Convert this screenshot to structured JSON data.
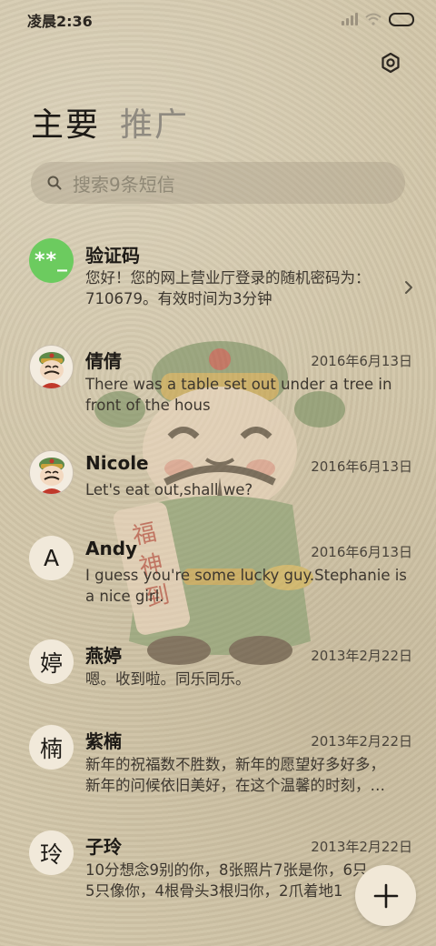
{
  "status_bar": {
    "time": "凌晨2:36"
  },
  "header": {
    "settings_icon": "gear-icon"
  },
  "tabs": [
    {
      "label": "主要",
      "active": true
    },
    {
      "label": "推广",
      "active": false
    }
  ],
  "search": {
    "placeholder": "搜索9条短信"
  },
  "messages": [
    {
      "name": "验证码",
      "avatar_text": "**_",
      "avatar_type": "code",
      "date": "",
      "preview": "您好！您的网上营业厅登录的随机密码为：\n710679。有效时间为3分钟",
      "has_chevron": true
    },
    {
      "name": "倩倩",
      "avatar_type": "photo",
      "date": "2016年6月13日",
      "preview": "There was a table set out under a tree in\nfront of the hous"
    },
    {
      "name": "Nicole",
      "avatar_type": "photo",
      "date": "2016年6月13日",
      "preview": "Let's eat out,shall we?"
    },
    {
      "name": "Andy",
      "avatar_text": "A",
      "avatar_type": "letter",
      "date": "2016年6月13日",
      "preview": "I guess you're some lucky guy.Stephanie is\na nice girl."
    },
    {
      "name": "燕婷",
      "avatar_text": "婷",
      "avatar_type": "letter",
      "date": "2013年2月22日",
      "preview": "嗯。收到啦。同乐同乐。"
    },
    {
      "name": "紫楠",
      "avatar_text": "楠",
      "avatar_type": "letter",
      "date": "2013年2月22日",
      "preview": "新年的祝福数不胜数，新年的愿望好多好多，\n新年的问候依旧美好，在这个温馨的时刻，…"
    },
    {
      "name": "子玲",
      "avatar_text": "玲",
      "avatar_type": "letter",
      "date": "2013年2月22日",
      "preview": "10分想念9别的你，8张照片7张是你，6只\n5只像你，4根骨头3根归你，2爪着地1"
    }
  ],
  "fab": {
    "icon": "plus-icon"
  },
  "colors": {
    "background": "#d2c6a9",
    "code_avatar": "#6ccb5f",
    "inactive_tab": "#8f8a80"
  }
}
